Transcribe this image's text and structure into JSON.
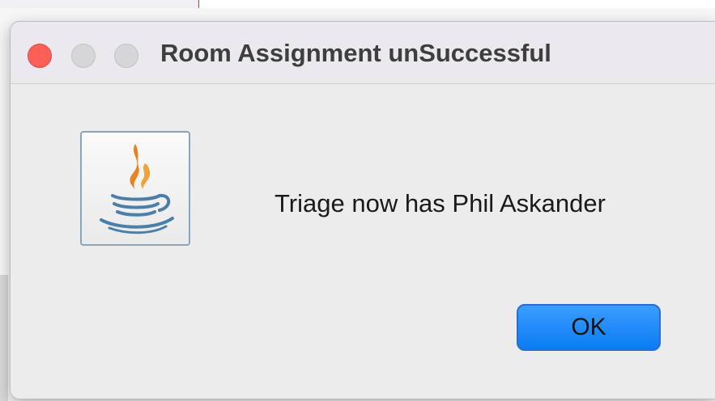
{
  "dialog": {
    "title": "Room Assignment unSuccessful",
    "message": "Triage now has Phil Askander",
    "ok_label": "OK",
    "icon": "java-coffee-cup-icon"
  },
  "colors": {
    "close_button": "#fe5f57",
    "inactive_button": "#d6d5d8",
    "ok_button": "#0a7cf3",
    "window_background": "#ececec"
  }
}
